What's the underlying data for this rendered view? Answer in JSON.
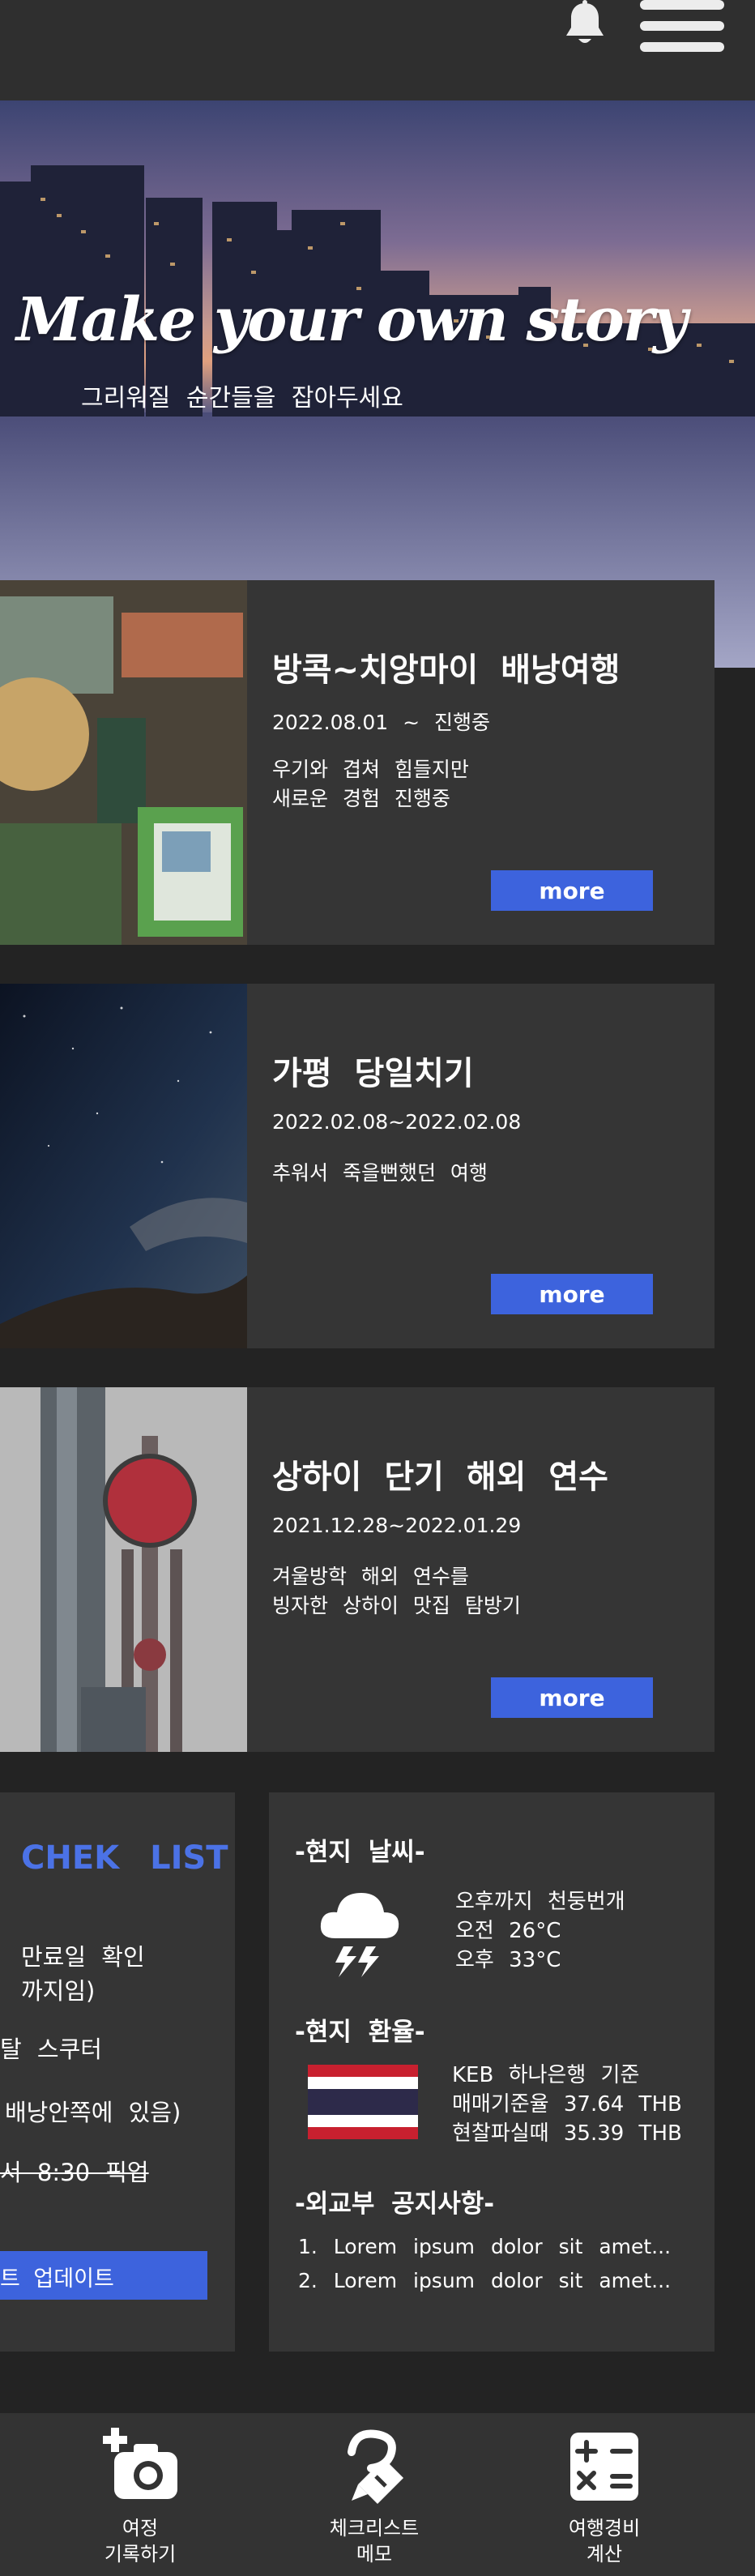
{
  "header": {
    "bell_icon": "bell-icon",
    "menu_icon": "hamburger-menu-icon"
  },
  "hero": {
    "title": "Make your own story",
    "subtitle": "그리워질 순간들을 잡아두세요"
  },
  "trips": [
    {
      "title": "방콕~치앙마이 배낭여행",
      "date": "2022.08.01 ~ 진행중",
      "desc_line1": "우기와 겹쳐 힘들지만",
      "desc_line2": "새로운 경험 진행중",
      "more_label": "more"
    },
    {
      "title": "가평 당일치기",
      "date": "2022.02.08~2022.02.08",
      "desc_line1": "추워서 죽을뻔했던 여행",
      "desc_line2": "",
      "more_label": "more"
    },
    {
      "title": "상하이 단기 해외 연수",
      "date": "2021.12.28~2022.01.29",
      "desc_line1": "겨울방학 해외 연수를",
      "desc_line2": "빙자한 상하이 맛집 탐방기",
      "more_label": "more"
    }
  ],
  "checklist": {
    "title": "CHEK LIST",
    "item1_line1": "만료일 확인",
    "item1_line2": "까지임)",
    "item2": "탈 스쿠터",
    "item3": "배낭안쪽에 있음)",
    "item4": "서 8:30 픽업",
    "update_label": "트 업데이트"
  },
  "weather": {
    "heading": "-현지 날씨-",
    "line1": "오후까지 천둥번개",
    "line2": "오전 26°C",
    "line3": "오후 33°C",
    "icon": "thunderstorm-cloud-icon"
  },
  "exchange": {
    "heading": "-현지 환율-",
    "line1": "KEB 하나은행 기준",
    "line2": "매매기준율 37.64 THB",
    "line3": "현찰파실때 35.39 THB",
    "icon": "thailand-flag-icon"
  },
  "notice": {
    "heading": "-외교부 공지사항-",
    "item1": "1. Lorem ipsum dolor sit amet...",
    "item2": "2. Lorem ipsum dolor sit amet..."
  },
  "bottom_nav": [
    {
      "label": "여정\n기록하기",
      "icon": "add-photo-camera-icon"
    },
    {
      "label": "체크리스트\n메모",
      "icon": "edit-pen-icon"
    },
    {
      "label": "여행경비\n계산",
      "icon": "calculator-icon"
    }
  ],
  "colors": {
    "accent": "#3d63dd",
    "card_bg": "#353535",
    "page_bg": "#232323"
  }
}
